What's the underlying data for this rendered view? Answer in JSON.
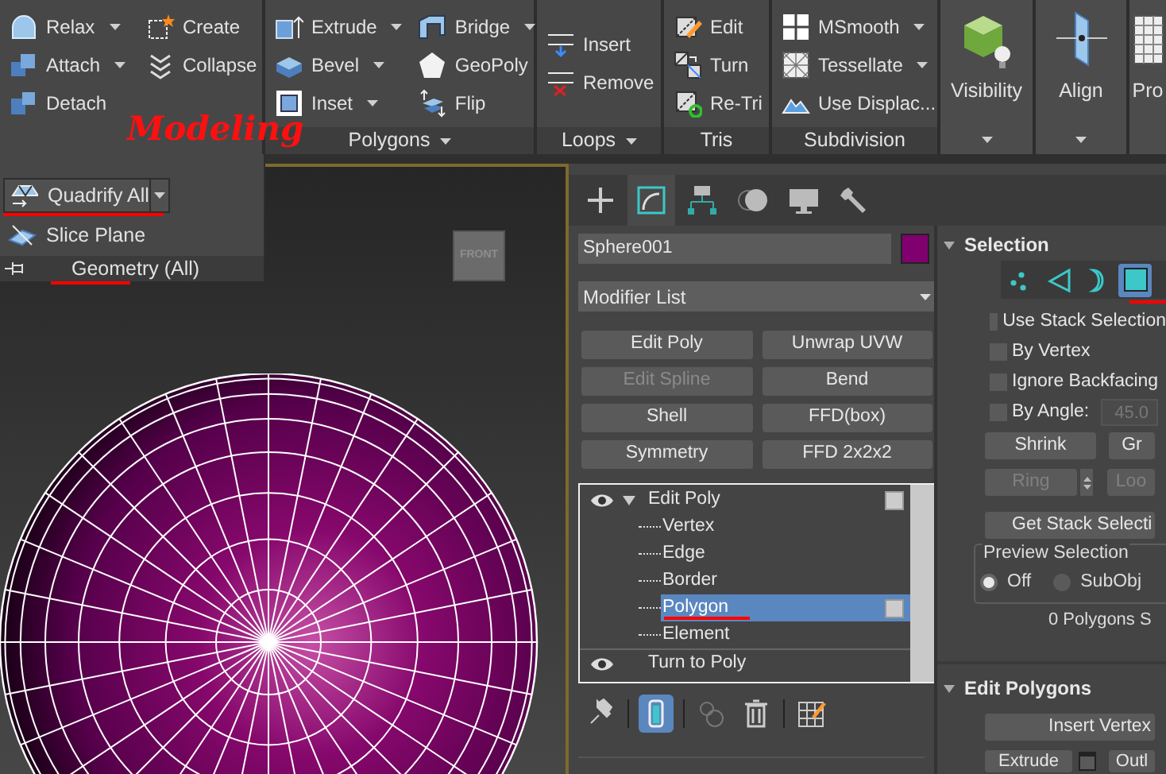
{
  "ribbon": {
    "groups": [
      {
        "kind": "tools",
        "columns": [
          [
            {
              "label": "Relax",
              "dropdown": true
            },
            {
              "label": "Attach",
              "dropdown": true
            },
            {
              "label": "Detach",
              "dropdown": false
            }
          ],
          [
            {
              "label": "Create",
              "dropdown": false
            },
            {
              "label": "Collapse",
              "dropdown": false
            }
          ]
        ]
      },
      {
        "kind": "tools",
        "label": "Polygons",
        "label_dropdown": true,
        "columns": [
          [
            {
              "label": "Extrude",
              "dropdown": true
            },
            {
              "label": "Bevel",
              "dropdown": true
            },
            {
              "label": "Inset",
              "dropdown": true
            }
          ],
          [
            {
              "label": "Bridge",
              "dropdown": true
            },
            {
              "label": "GeoPoly",
              "dropdown": false
            },
            {
              "label": "Flip",
              "dropdown": false
            }
          ]
        ]
      },
      {
        "kind": "tools",
        "label": "Loops",
        "label_dropdown": true,
        "columns": [
          [
            {
              "label": "Insert",
              "dropdown": false
            },
            {
              "label": "Remove",
              "dropdown": false
            }
          ]
        ]
      },
      {
        "kind": "tools",
        "label": "Tris",
        "label_dropdown": false,
        "columns": [
          [
            {
              "label": "Edit",
              "dropdown": false
            },
            {
              "label": "Turn",
              "dropdown": false
            },
            {
              "label": "Re-Tri",
              "dropdown": false
            }
          ]
        ]
      },
      {
        "kind": "tools",
        "label": "Subdivision",
        "label_dropdown": false,
        "columns": [
          [
            {
              "label": "MSmooth",
              "dropdown": true
            },
            {
              "label": "Tessellate",
              "dropdown": true
            },
            {
              "label": "Use Displac...",
              "dropdown": false
            }
          ]
        ]
      },
      {
        "kind": "large",
        "label": "Visibility",
        "dropdown": true
      },
      {
        "kind": "large",
        "label": "Align",
        "dropdown": true
      },
      {
        "kind": "large",
        "label": "Pro",
        "dropdown": false
      }
    ]
  },
  "geometry_panel": {
    "buttons": [
      {
        "label": "Quadrify All",
        "dropdown": true,
        "marked": true
      },
      {
        "label": "Slice Plane",
        "dropdown": false,
        "marked": false
      }
    ],
    "title": "Geometry (All)",
    "title_marked": true
  },
  "annotation": {
    "text": "Modeling"
  },
  "viewport": {
    "view_cube": "FRONT"
  },
  "command_panel": {
    "tabs": [
      {
        "selected": false
      },
      {
        "selected": true
      },
      {
        "selected": false
      },
      {
        "selected": false
      },
      {
        "selected": false
      },
      {
        "selected": false
      }
    ],
    "object_name": "Sphere001",
    "modifier_list": "Modifier List",
    "modifier_buttons": [
      {
        "label": "Edit Poly",
        "disabled": false
      },
      {
        "label": "Unwrap UVW",
        "disabled": false
      },
      {
        "label": "Edit Spline",
        "disabled": true
      },
      {
        "label": "Bend",
        "disabled": false
      },
      {
        "label": "Shell",
        "disabled": false
      },
      {
        "label": "FFD(box)",
        "disabled": false
      },
      {
        "label": "Symmetry",
        "disabled": false
      },
      {
        "label": "FFD 2x2x2",
        "disabled": false
      }
    ],
    "stack": [
      {
        "label": "Edit Poly",
        "expanded": true,
        "selected": false,
        "children": [
          {
            "label": "Vertex",
            "selected": false,
            "marked": false
          },
          {
            "label": "Edge",
            "selected": false,
            "marked": false
          },
          {
            "label": "Border",
            "selected": false,
            "marked": false
          },
          {
            "label": "Polygon",
            "selected": true,
            "marked": true
          },
          {
            "label": "Element",
            "selected": false,
            "marked": false
          }
        ]
      },
      {
        "label": "Turn to Poly",
        "expanded": false,
        "selected": false
      }
    ],
    "stack_tools": [
      {
        "selected": false
      },
      {
        "selected": true
      },
      {
        "selected": false
      },
      {
        "selected": false
      },
      {
        "selected": false
      }
    ]
  },
  "selection_rollout": {
    "title": "Selection",
    "expanded": true,
    "subobjects": [
      {
        "selected": false,
        "marked": false
      },
      {
        "selected": false,
        "marked": false
      },
      {
        "selected": false,
        "marked": false
      },
      {
        "selected": true,
        "marked": true
      }
    ],
    "checkboxes": [
      {
        "label": "Use Stack Selection",
        "checked": false
      },
      {
        "label": "By Vertex",
        "checked": false
      },
      {
        "label": "Ignore Backfacing",
        "checked": false
      },
      {
        "label": "By Angle:",
        "checked": false
      }
    ],
    "angle": {
      "value": "45.0",
      "disabled": true
    },
    "button_rows": [
      [
        {
          "label": "Shrink",
          "disabled": false
        },
        {
          "label": "Gr",
          "disabled": false
        }
      ],
      [
        {
          "label": "Ring",
          "disabled": true
        },
        {
          "label": "Loo",
          "disabled": true
        }
      ]
    ],
    "get_stack_button": "Get Stack Selecti",
    "preview": {
      "title": "Preview Selection",
      "options": [
        {
          "label": "Off",
          "selected": true
        },
        {
          "label": "SubObj",
          "selected": false
        }
      ]
    },
    "status": "0 Polygons S"
  },
  "edit_polygons_rollout": {
    "title": "Edit Polygons",
    "expanded": true,
    "insert_button": "Insert Vertex",
    "extrude_button": "Extrude",
    "outline_button": "Outl"
  }
}
